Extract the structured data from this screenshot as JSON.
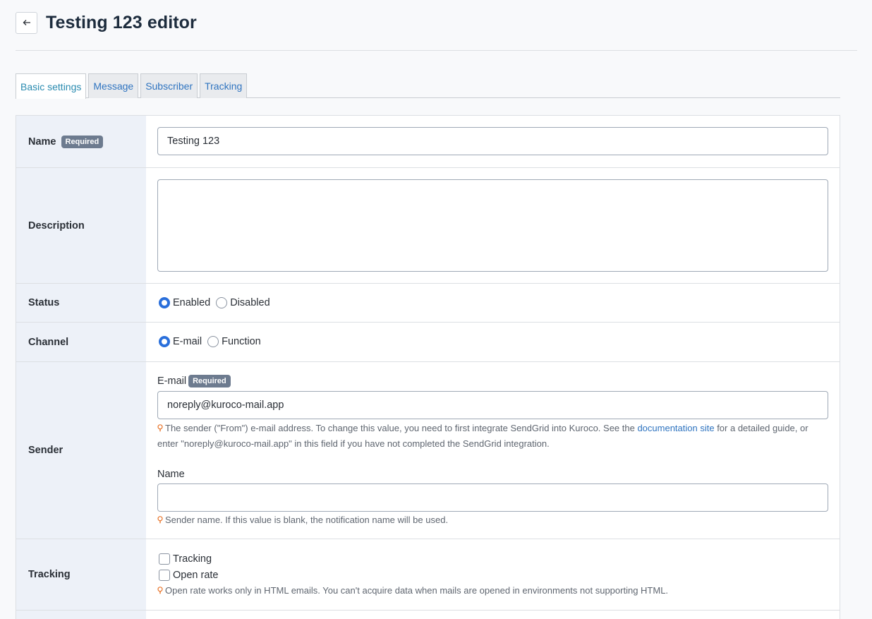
{
  "header": {
    "title": "Testing 123 editor",
    "back_icon": "arrow-left-icon"
  },
  "tabs": [
    {
      "label": "Basic settings",
      "active": true
    },
    {
      "label": "Message",
      "active": false
    },
    {
      "label": "Subscriber",
      "active": false
    },
    {
      "label": "Tracking",
      "active": false
    }
  ],
  "form": {
    "required_badge": "Required",
    "name": {
      "label": "Name",
      "value": "Testing 123"
    },
    "description": {
      "label": "Description",
      "value": ""
    },
    "status": {
      "label": "Status",
      "options": [
        {
          "label": "Enabled",
          "checked": true
        },
        {
          "label": "Disabled",
          "checked": false
        }
      ]
    },
    "channel": {
      "label": "Channel",
      "options": [
        {
          "label": "E-mail",
          "checked": true
        },
        {
          "label": "Function",
          "checked": false
        }
      ]
    },
    "sender": {
      "label": "Sender",
      "email_label": "E-mail",
      "email_value": "noreply@kuroco-mail.app",
      "email_hint_before": "The sender (\"From\") e-mail address. To change this value, you need to first integrate SendGrid into Kuroco. See the ",
      "email_hint_link": "documentation site",
      "email_hint_after": " for a detailed guide, or enter \"noreply@kuroco-mail.app\" in this field if you have not completed the SendGrid integration.",
      "name_label": "Name",
      "name_value": "",
      "name_hint": "Sender name. If this value is blank, the notification name will be used."
    },
    "tracking": {
      "label": "Tracking",
      "options": [
        {
          "label": "Tracking",
          "checked": false
        },
        {
          "label": "Open rate",
          "checked": false
        }
      ],
      "hint": "Open rate works only in HTML emails. You can't acquire data when mails are opened in environments not supporting HTML."
    }
  },
  "colors": {
    "accent": "#2a6fdb",
    "link": "#2f74c0",
    "badge": "#6d7b8f",
    "hint_icon": "#e8742a",
    "label_bg": "#edf1f8"
  }
}
